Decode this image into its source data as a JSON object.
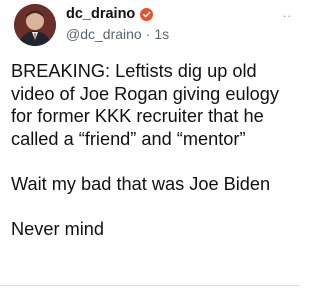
{
  "tweet": {
    "author": {
      "display_name": "dc_draino",
      "handle": "@dc_draino",
      "separator": "·",
      "time": "1s",
      "verified_icon": "verified-badge-icon",
      "avatar_icon": "profile-photo"
    },
    "more_icon": "more-options-icon",
    "more_glyph": "..",
    "paragraphs": [
      "BREAKING: Leftists dig up old video of Joe Rogan giving eulogy for former KKK recruiter that he called a “friend” and “mentor”",
      "Wait my bad that was Joe Biden",
      "Never mind"
    ]
  },
  "colors": {
    "verified": "#e8512a",
    "text": "#111111",
    "secondary": "#5b6670"
  }
}
